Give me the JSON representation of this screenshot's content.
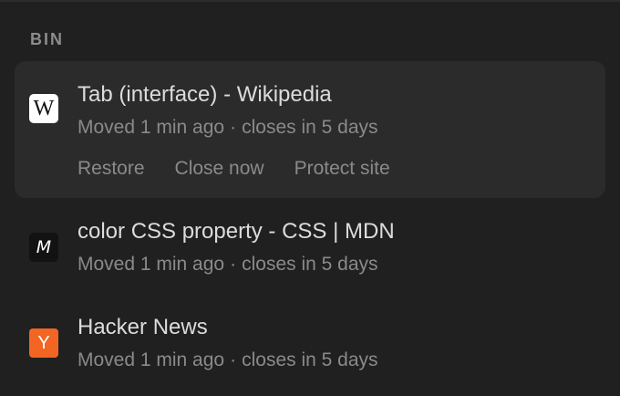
{
  "section": {
    "title": "BIN"
  },
  "items": [
    {
      "favicon_glyph": "W",
      "favicon_icon": "wikipedia-icon",
      "title": "Tab (interface) - Wikipedia",
      "moved": "Moved 1 min ago",
      "separator": "·",
      "closes": "closes in 5 days",
      "expanded": true,
      "actions": [
        "Restore",
        "Close now",
        "Protect site"
      ]
    },
    {
      "favicon_glyph": "M",
      "favicon_icon": "mdn-icon",
      "title": "color CSS property - CSS | MDN",
      "moved": "Moved 1 min ago",
      "separator": "·",
      "closes": "closes in 5 days"
    },
    {
      "favicon_glyph": "Y",
      "favicon_icon": "hacker-news-icon",
      "title": "Hacker News",
      "moved": "Moved 1 min ago",
      "separator": "·",
      "closes": "closes in 5 days"
    }
  ],
  "colors": {
    "background": "#202020",
    "card": "#2b2b2b",
    "title_text": "#dcdcdc",
    "secondary_text": "#8a8a8a",
    "hn_orange": "#f26522"
  }
}
